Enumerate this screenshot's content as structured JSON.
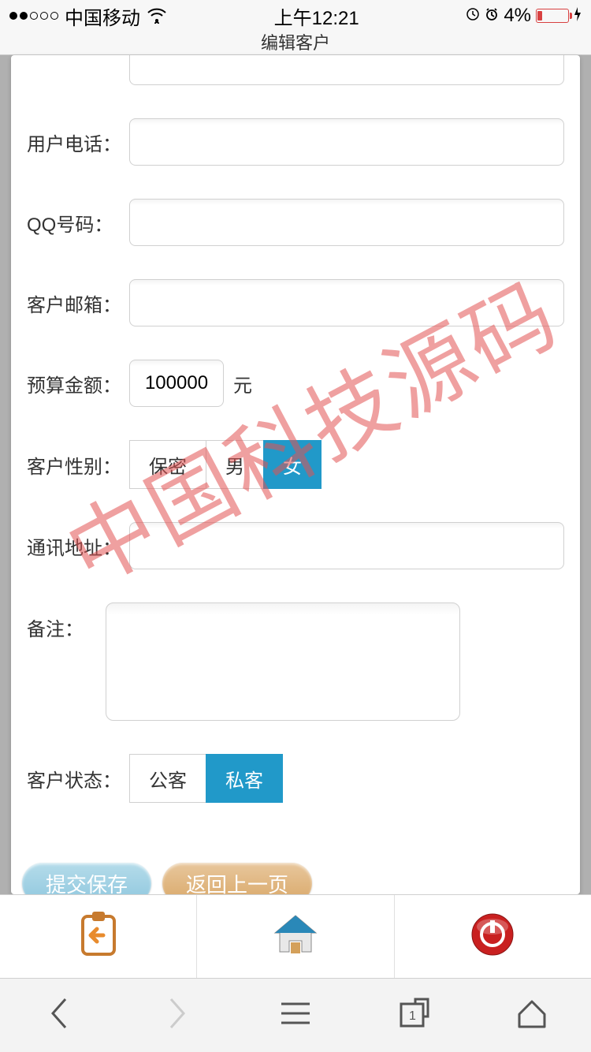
{
  "status": {
    "carrier": "中国移动",
    "time": "上午12:21",
    "battery_pct": "4%"
  },
  "page_title": "编辑客户",
  "form": {
    "phone_label": "用户电话：",
    "phone_value": "",
    "qq_label": "QQ号码：",
    "qq_value": "",
    "email_label": "客户邮箱：",
    "email_value": "",
    "budget_label": "预算金额：",
    "budget_value": "100000",
    "budget_unit": "元",
    "gender_label": "客户性别：",
    "gender_options": {
      "secret": "保密",
      "male": "男",
      "female": "女"
    },
    "gender_selected": "female",
    "address_label": "通讯地址：",
    "address_value": "",
    "remarks_label": "备注：",
    "remarks_value": "",
    "status_label": "客户状态：",
    "status_options": {
      "public": "公客",
      "private": "私客"
    },
    "status_selected": "private"
  },
  "buttons": {
    "submit": "提交保存",
    "back": "返回上一页"
  },
  "watermark": "中国科技源码"
}
